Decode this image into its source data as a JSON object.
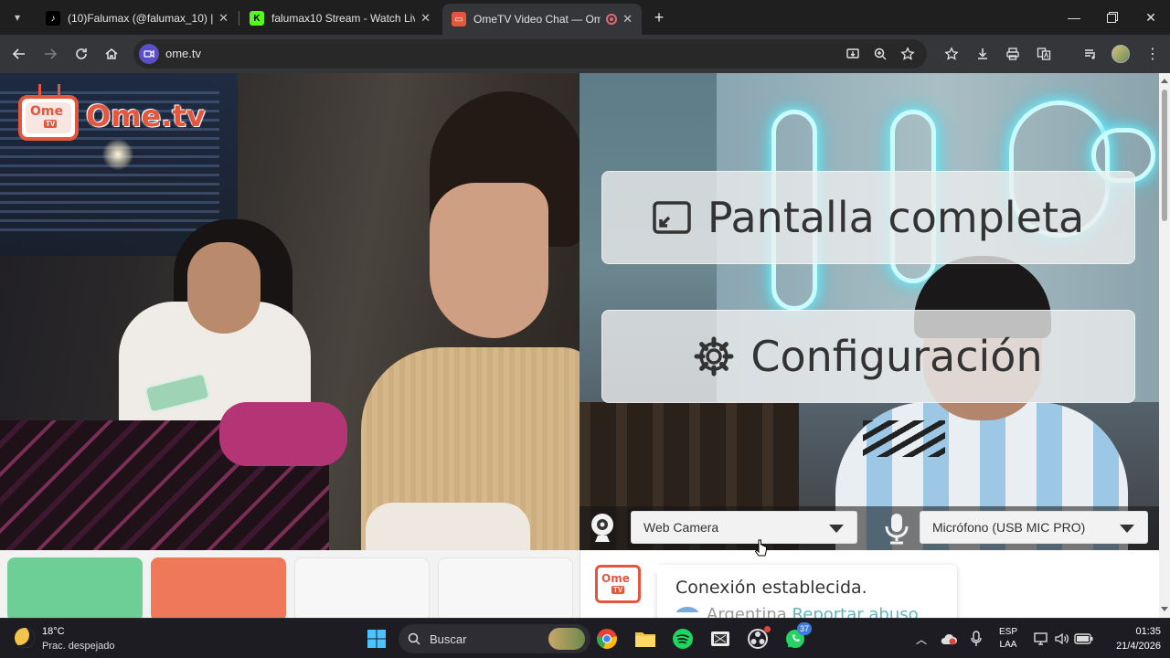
{
  "browser": {
    "tabs": [
      {
        "title": "(10)Falumax (@falumax_10) | Ti",
        "active": false,
        "favicon": "tiktok-icon"
      },
      {
        "title": "falumax10 Stream - Watch Live",
        "active": false,
        "favicon": "kick-icon"
      },
      {
        "title": "OmeTV Video Chat — Ome",
        "active": true,
        "favicon": "ometv-icon"
      }
    ],
    "new_tab": "+",
    "address": "ome.tv"
  },
  "page": {
    "logo_text": "Ome.tv",
    "logo_badge_top": "Ome",
    "logo_badge_bottom": "TV",
    "fullscreen_label": "Pantalla completa",
    "settings_label": "Configuración",
    "camera_select": "Web Camera",
    "mic_select": "Micrófono (USB MIC PRO)",
    "chat": {
      "logo_top": "Ome",
      "logo_bottom": "TV",
      "message": "Conexión establecida.",
      "country": "Argentina",
      "report": "Reportar abuso"
    },
    "tile_colors": [
      "#6dcf96",
      "#f0785a",
      "#f7f7f7",
      "#f7f7f7"
    ]
  },
  "taskbar": {
    "weather_temp": "18°C",
    "weather_cond": "Prac. despejado",
    "search_placeholder": "Buscar",
    "whatsapp_badge": "37",
    "lang_top": "ESP",
    "lang_bottom": "LAA",
    "time": "01:35",
    "date": "21/4/2026"
  },
  "colors": {
    "brand": "#e5563e",
    "report_link": "#5fb4b9"
  }
}
